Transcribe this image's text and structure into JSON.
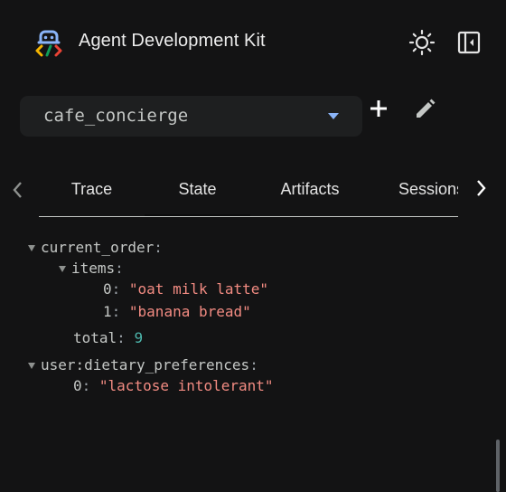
{
  "header": {
    "title": "Agent Development Kit",
    "logo_icon": "adk-logo",
    "theme_icon": "sun-icon",
    "panel_icon": "sidebar-collapse-icon"
  },
  "app_selector": {
    "selected": "cafe_concierge",
    "add_icon": "plus-icon",
    "edit_icon": "pencil-icon"
  },
  "tabs": {
    "items": [
      {
        "label": "Trace"
      },
      {
        "label": "State"
      },
      {
        "label": "Artifacts"
      },
      {
        "label": "Sessions"
      }
    ],
    "active": "State"
  },
  "state": {
    "current_order_key": "current_order",
    "items_key": "items",
    "item_0_index": "0",
    "item_0_value": "\"oat milk latte\"",
    "item_1_index": "1",
    "item_1_value": "\"banana bread\"",
    "total_key": "total",
    "total_value": "9",
    "dietary_key": "user:dietary_preferences",
    "dietary_0_index": "0",
    "dietary_0_value": "\"lactose intolerant\""
  },
  "colors": {
    "background": "#131314",
    "string_value": "#f28b82",
    "number_value": "#4db6ac",
    "accent": "#8ab4f8"
  }
}
